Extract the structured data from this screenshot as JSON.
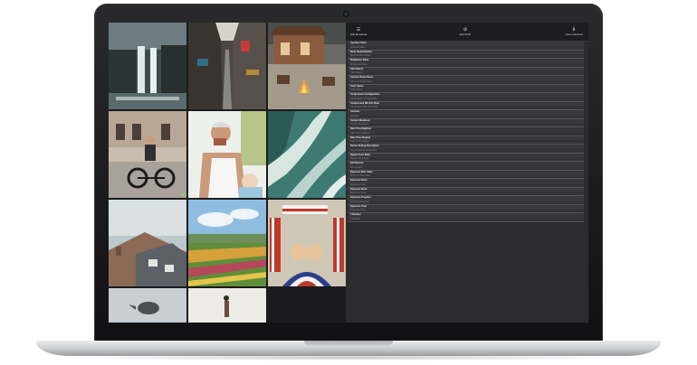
{
  "toolbar": {
    "select_label": "Edit Metadata",
    "edit_label": "Edit EXIF",
    "save_label": "Save selected",
    "select_icon": "list-icon",
    "edit_icon": "gear-icon",
    "save_icon": "save-icon"
  },
  "photos": [
    {
      "name": "photo-waterfall"
    },
    {
      "name": "photo-city-street"
    },
    {
      "name": "photo-campfire-cabin"
    },
    {
      "name": "photo-man-on-bicycle"
    },
    {
      "name": "photo-father-and-baby"
    },
    {
      "name": "photo-ocean-waves"
    },
    {
      "name": "photo-rooftops"
    },
    {
      "name": "photo-flower-fields"
    },
    {
      "name": "photo-flags-parade"
    },
    {
      "name": "photo-bird"
    },
    {
      "name": "photo-person-beach"
    }
  ],
  "metadata_fields": [
    {
      "label": "Aperture Value",
      "value": "Aperture Value"
    },
    {
      "label": "Body Serial Number",
      "value": "Body Serial Number"
    },
    {
      "label": "Brightness Value",
      "value": "Brightness Value"
    },
    {
      "label": "CFA Pattern",
      "value": "CFA Pattern"
    },
    {
      "label": "Camera Owner Name",
      "value": "Camera Owner Name"
    },
    {
      "label": "Color Space",
      "value": "Color Space"
    },
    {
      "label": "Components Configuration",
      "value": "Components Configuration"
    },
    {
      "label": "Compressed Bits Per Pixel",
      "value": "Compressed Bits Per Pixel"
    },
    {
      "label": "Contrast",
      "value": "Contrast"
    },
    {
      "label": "Custom Rendered",
      "value": "Custom Rendered"
    },
    {
      "label": "Date Time Digitized",
      "value": "Date Time Digitized"
    },
    {
      "label": "Date Time Original",
      "value": "Date Time Original"
    },
    {
      "label": "Device Setting Description",
      "value": "Device Setting Description"
    },
    {
      "label": "Digital Zoom Ratio",
      "value": "Digital Zoom Ratio"
    },
    {
      "label": "Exif Version",
      "value": "Exif Version"
    },
    {
      "label": "Exposure Bias Value",
      "value": "Exposure Bias Value"
    },
    {
      "label": "Exposure Index",
      "value": "Exposure Index"
    },
    {
      "label": "Exposure Mode",
      "value": "Exposure Mode"
    },
    {
      "label": "Exposure Program",
      "value": "Exposure Program"
    },
    {
      "label": "Exposure Time",
      "value": "Exposure Time"
    },
    {
      "label": "F Number",
      "value": "F Number"
    }
  ]
}
